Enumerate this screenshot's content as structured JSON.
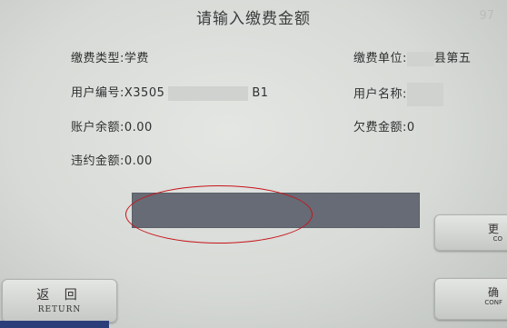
{
  "header": {
    "title": "请输入缴费金额",
    "corner": "97"
  },
  "fields": {
    "fee_type": "缴费类型:学费",
    "fee_unit_label": "缴费单位:",
    "fee_unit_value": "县第五",
    "user_id_label": "用户编号:X3505",
    "user_id_suffix": "B1",
    "user_name_label": "用户名称:",
    "balance": "账户余额:0.00",
    "arrears": "欠费金额:0",
    "penalty": "违约金额:0.00"
  },
  "buttons": {
    "return_cn": "返 回",
    "return_en": "RETURN",
    "right1_cn": "更",
    "right1_en": "CO",
    "right2_cn": "确",
    "right2_en": "CONF"
  },
  "colors": {
    "amount_bar": "#666b75",
    "highlight": "#c8141b"
  }
}
